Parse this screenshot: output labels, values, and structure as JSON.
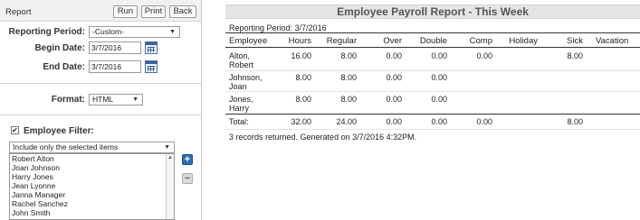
{
  "sidebar": {
    "title": "Report",
    "buttons": {
      "run": "Run",
      "print": "Print",
      "back": "Back"
    },
    "reporting_period_label": "Reporting Period:",
    "reporting_period_value": "-Custom-",
    "begin_date_label": "Begin Date:",
    "begin_date_value": "3/7/2016",
    "end_date_label": "End Date:",
    "end_date_value": "3/7/2016",
    "format_label": "Format:",
    "format_value": "HTML",
    "employee_filter_label": "Employee Filter:",
    "employee_filter_checked": true,
    "filter_mode": "Include only the selected items",
    "employees": [
      "Robert Alton",
      "Joan Johnson",
      "Harry Jones",
      "Jean Lyonne",
      "Janna Manager",
      "Rachel Sanchez",
      "John Smith"
    ],
    "icons": {
      "calendar": "calendar-icon",
      "add": "plus-icon",
      "remove": "minus-icon",
      "dropdown": "chevron-down-icon"
    },
    "accent_color": "#2f6db5"
  },
  "report": {
    "title": "Employee Payroll Report - This Week",
    "reporting_period": "Reporting Period:  3/7/2016",
    "columns": [
      "Employee",
      "Hours",
      "Regular",
      "Over",
      "Double",
      "Comp",
      "Holiday",
      "Sick",
      "Vacation"
    ],
    "rows": [
      {
        "employee_line1": "Alton,",
        "employee_line2": "Robert",
        "hours": "16.00",
        "regular": "8.00",
        "over": "0.00",
        "double": "0.00",
        "comp": "0.00",
        "holiday": "",
        "sick": "8.00",
        "vacation": ""
      },
      {
        "employee_line1": "Johnson,",
        "employee_line2": "Joan",
        "hours": "8.00",
        "regular": "8.00",
        "over": "0.00",
        "double": "0.00",
        "comp": "",
        "holiday": "",
        "sick": "",
        "vacation": ""
      },
      {
        "employee_line1": "Jones,",
        "employee_line2": "Harry",
        "hours": "8.00",
        "regular": "8.00",
        "over": "0.00",
        "double": "0.00",
        "comp": "",
        "holiday": "",
        "sick": "",
        "vacation": ""
      }
    ],
    "total": {
      "label": "Total:",
      "hours": "32.00",
      "regular": "24.00",
      "over": "0.00",
      "double": "0.00",
      "comp": "0.00",
      "holiday": "",
      "sick": "8.00",
      "vacation": ""
    },
    "footer": "3 records returned. Generated on 3/7/2016 4:32PM."
  }
}
